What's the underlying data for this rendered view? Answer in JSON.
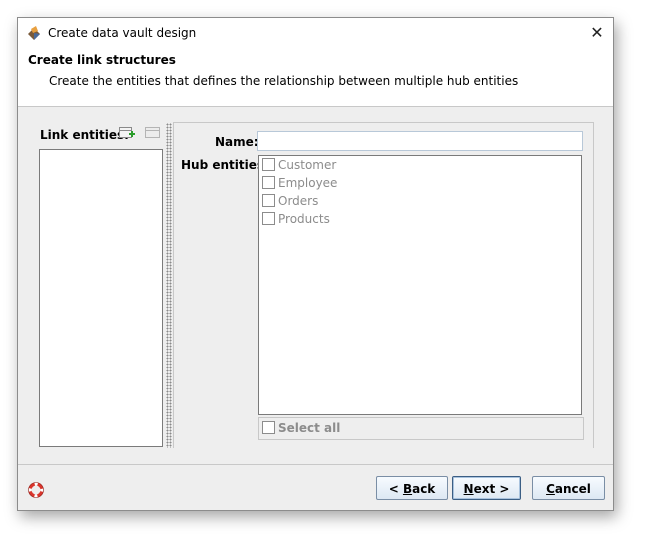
{
  "window": {
    "title": "Create data vault design",
    "close_glyph": "✕"
  },
  "header": {
    "title": "Create link structures",
    "description": "Create the entities that defines the relationship between multiple hub entities"
  },
  "left_panel": {
    "label": "Link entities:",
    "add_icon": "add-entity-icon",
    "remove_icon": "remove-entity-icon",
    "items": []
  },
  "form": {
    "name_label": "Name:",
    "name_value": "",
    "hub_label": "Hub entities:",
    "hub_items": [
      {
        "label": "Customer",
        "checked": false
      },
      {
        "label": "Employee",
        "checked": false
      },
      {
        "label": "Orders",
        "checked": false
      },
      {
        "label": "Products",
        "checked": false
      }
    ],
    "select_all_label": "Select all"
  },
  "footer": {
    "back": {
      "prefix": "< ",
      "mnemonic": "B",
      "rest": "ack"
    },
    "next": {
      "mnemonic": "N",
      "rest": "ext >"
    },
    "cancel": {
      "mnemonic": "C",
      "rest": "ancel"
    }
  },
  "colors": {
    "dialog_bg": "#eeeeee",
    "disabled_text": "#8c8c8c",
    "button_border": "#7a8ea5",
    "add_icon_green": "#2a9d2a",
    "help_icon_red": "#d9342b"
  }
}
